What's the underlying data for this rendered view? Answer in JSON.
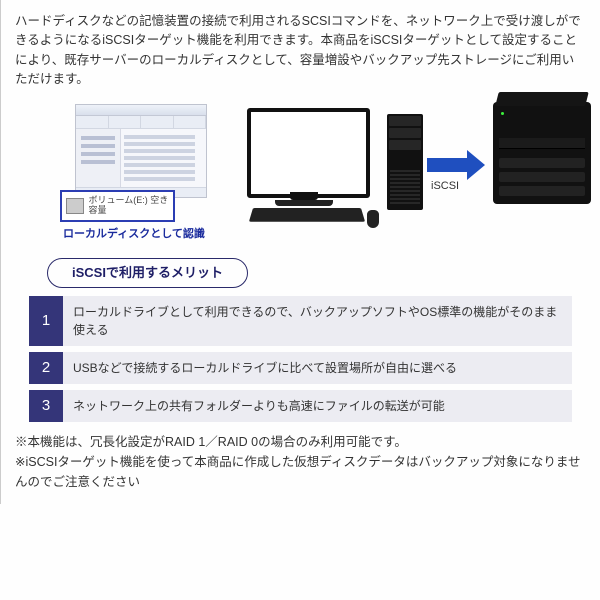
{
  "intro": "ハードディスクなどの記憶装置の接続で利用されるSCSIコマンドを、ネットワーク上で受け渡しができるようになるiSCSIターゲット機能を利用できます。本商品をiSCSIターゲットとして設定することにより、既存サーバーのローカルディスクとして、容量増設やバックアップ先ストレージにご利用いただけます。",
  "diagram": {
    "callout_small": "ボリューム(E:)\n空き容量",
    "callout_label": "ローカルディスクとして認識",
    "arrow_label": "iSCSI"
  },
  "benefits": {
    "heading": "iSCSIで利用するメリット",
    "items": [
      {
        "n": "1",
        "text": "ローカルドライブとして利用できるので、バックアップソフトやOS標準の機能がそのまま使える"
      },
      {
        "n": "2",
        "text": "USBなどで接続するローカルドライブに比べて設置場所が自由に選べる"
      },
      {
        "n": "3",
        "text": "ネットワーク上の共有フォルダーよりも高速にファイルの転送が可能"
      }
    ]
  },
  "footnotes": [
    "※本機能は、冗長化設定がRAID 1／RAID 0の場合のみ利用可能です。",
    "※iSCSIターゲット機能を使って本商品に作成した仮想ディスクデータはバックアップ対象になりませんのでご注意ください"
  ]
}
